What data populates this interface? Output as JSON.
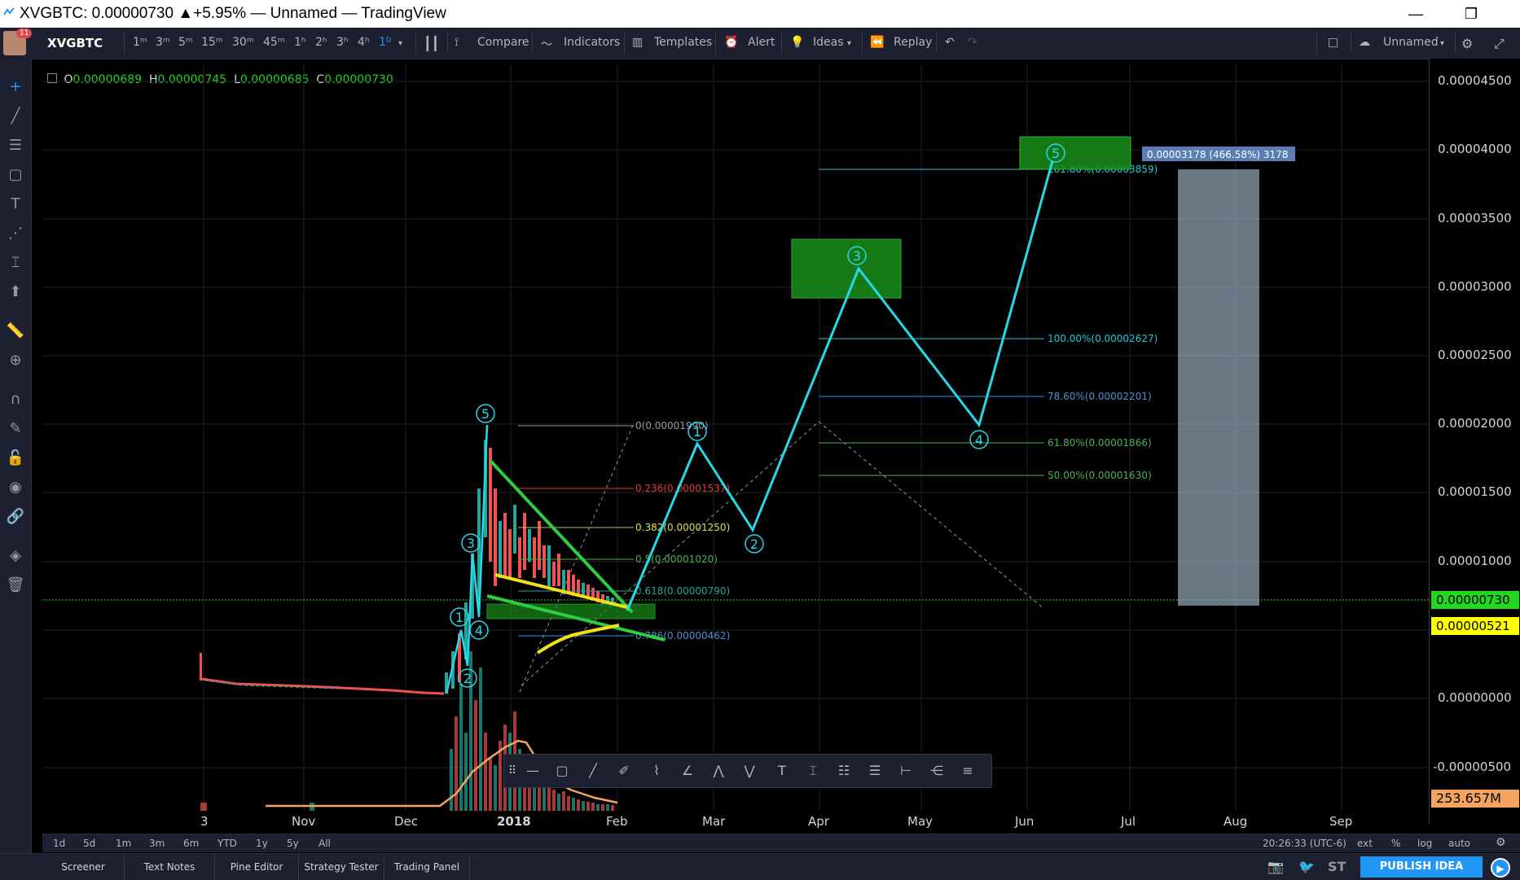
{
  "window": {
    "title": "XVGBTC: 0.00000730 ▲+5.95% — Unnamed — TradingView",
    "minimize": "—",
    "restore": "❐"
  },
  "toolbar": {
    "avatar_badge": "11",
    "symbol": "XVGBTC",
    "intervals": [
      "1ᵐ",
      "3ᵐ",
      "5ᵐ",
      "15ᵐ",
      "30ᵐ",
      "45ᵐ",
      "1ʰ",
      "2ʰ",
      "3ʰ",
      "4ʰ",
      "1ᴰ"
    ],
    "compare": "Compare",
    "indicators": "Indicators",
    "templates": "Templates",
    "alert": "Alert",
    "ideas": "Ideas",
    "replay": "Replay",
    "layout_name": "Unnamed"
  },
  "ohlc": {
    "o_label": "O",
    "o": "0.00000689",
    "h_label": "H",
    "h": "0.00000745",
    "l_label": "L",
    "l": "0.00000685",
    "c_label": "C",
    "c": "0.00000730"
  },
  "price_axis": {
    "ticks": [
      "0.00004500",
      "0.00004000",
      "0.00003500",
      "0.00003000",
      "0.00002500",
      "0.00002000",
      "0.00001500",
      "0.00001000",
      "0.00000500",
      "0.00000000",
      "-0.00000500"
    ],
    "last_price": "0.00000730",
    "level_label": "0.00000521",
    "volume_label": "253.657M",
    "colors": {
      "last": "#22d622",
      "level": "#ffff00",
      "volume": "#f4a460"
    }
  },
  "time_axis": {
    "labels": [
      "3",
      "Nov",
      "Dec",
      "2018",
      "Feb",
      "Mar",
      "Apr",
      "May",
      "Jun",
      "Jul",
      "Aug",
      "Sep"
    ]
  },
  "annotations": {
    "fib_left": [
      "0(0.00001990)",
      "0.236(0.00001537)",
      "0.382(0.00001250)",
      "0.5(0.00001020)",
      "0.618(0.00000790)",
      "0.786(0.00000462)"
    ],
    "fib_right": [
      "161.80%(0.00003859)",
      "100.00%(0.00002627)",
      "78.60%(0.00002201)",
      "61.80%(0.00001866)",
      "50.00%(0.00001630)"
    ],
    "measure_label": "0.00003178 (466.58%) 3178",
    "wave_left": [
      "1",
      "2",
      "3",
      "4",
      "5"
    ],
    "wave_right": [
      "1",
      "2",
      "3",
      "4",
      "5"
    ]
  },
  "bottom_ranges": {
    "items": [
      "1d",
      "5d",
      "1m",
      "3m",
      "6m",
      "YTD",
      "1y",
      "5y",
      "All"
    ],
    "clock": "20:26:33 (UTC-6)",
    "ext": "ext",
    "percent": "%",
    "log": "log",
    "auto": "auto"
  },
  "bottom_tabs": {
    "items": [
      "Screener",
      "Text Notes",
      "Pine Editor",
      "Strategy Tester",
      "Trading Panel"
    ],
    "st": "ST",
    "publish": "PUBLISH IDEA"
  }
}
